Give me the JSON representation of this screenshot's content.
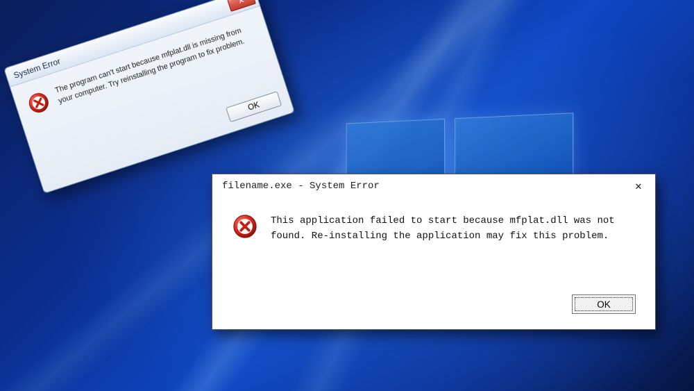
{
  "dialog1": {
    "title": "System Error",
    "message": "The program can't start because mfplat.dll is missing from your computer. Try reinstalling the program to fix problem.",
    "ok_label": "OK",
    "close_glyph": "✕"
  },
  "dialog2": {
    "title": "filename.exe - System Error",
    "message": "This application failed to start because mfplat.dll was not found. Re-installing the application may fix this problem.",
    "ok_label": "OK",
    "close_glyph": "✕"
  }
}
